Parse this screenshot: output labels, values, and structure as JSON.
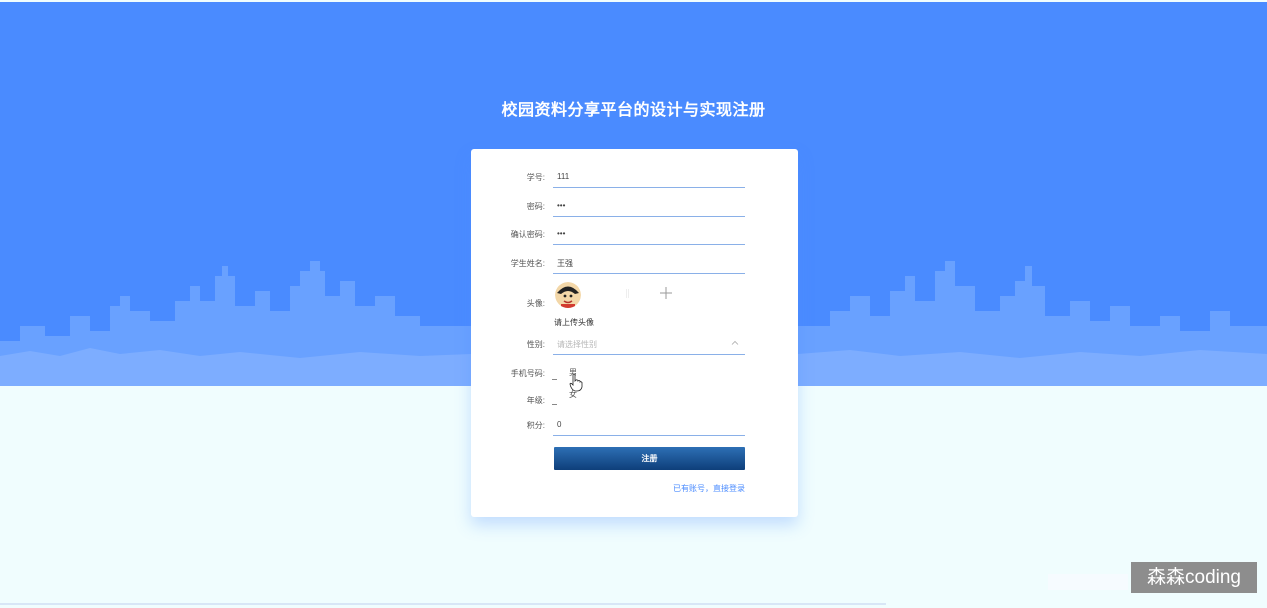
{
  "page": {
    "title": "校园资料分享平台的设计与实现注册"
  },
  "form": {
    "student_id": {
      "label": "学号:",
      "value": "111"
    },
    "password": {
      "label": "密码:",
      "value": "•••"
    },
    "confirm_password": {
      "label": "确认密码:",
      "value": "•••"
    },
    "student_name": {
      "label": "学生姓名:",
      "value": "王强"
    },
    "avatar": {
      "label": "头像:",
      "hint": "请上传头像"
    },
    "gender": {
      "label": "性别:",
      "placeholder": "请选择性别",
      "options": [
        "男",
        "女"
      ]
    },
    "phone": {
      "label": "手机号码:"
    },
    "grade": {
      "label": "年级:"
    },
    "points": {
      "label": "积分:",
      "value": "0"
    },
    "submit_label": "注册",
    "login_link": "已有账号，直接登录"
  },
  "watermark": "森森coding",
  "colors": {
    "hero": "#4a8bff",
    "button": "#0e3f7a",
    "link": "#4a8bff"
  }
}
